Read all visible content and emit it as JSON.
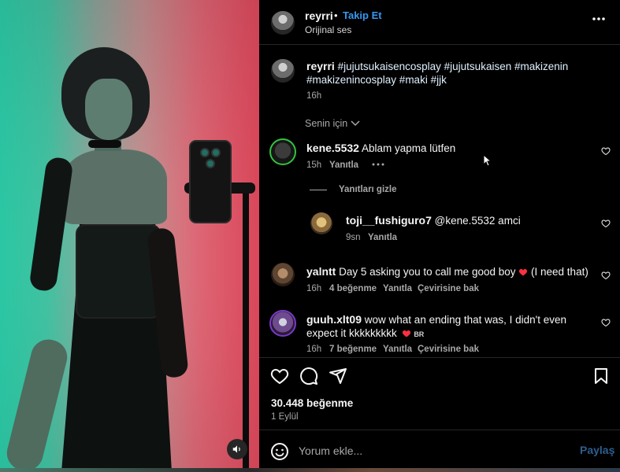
{
  "header": {
    "username": "reyrri",
    "separator": "•",
    "follow_label": "Takip Et",
    "audio_label": "Orijinal ses",
    "more_icon": "more-horizontal-icon"
  },
  "caption": {
    "username": "reyrri",
    "text": "#jujutsukaisencosplay #jujutsukaisen #makizenin #makizenincosplay #maki #jjk",
    "time": "16h"
  },
  "sort": {
    "label": "Senin için"
  },
  "comments": [
    {
      "username": "kene.5532",
      "text": "Ablam yapma lütfen",
      "time": "15h",
      "reply_label": "Yanıtla"
    },
    {
      "username": "toji__fushiguro7",
      "text": "@kene.5532 amci",
      "time": "9sn",
      "reply_label": "Yanıtla"
    },
    {
      "username": "yalntt",
      "text": "Day 5 asking you to call me good boy",
      "suffix": "(I need that)",
      "time": "16h",
      "likes": "4 beğenme",
      "reply_label": "Yanıtla",
      "translate_label": "Çevirisine bak"
    },
    {
      "username": "guuh.xlt09",
      "text": "wow what an ending that was, I didn't even expect it kkkkkkkkk",
      "flag": "BR",
      "time": "16h",
      "likes": "7 beğenme",
      "reply_label": "Yanıtla",
      "translate_label": "Çevirisine bak"
    }
  ],
  "hide_replies_label": "Yanıtları gizle",
  "actions": {
    "likes": "30.448 beğenme",
    "date": "1 Eylül"
  },
  "composer": {
    "placeholder": "Yorum ekle...",
    "post_label": "Paylaş"
  },
  "colors": {
    "follow": "#3797f0",
    "background": "#000000",
    "muted": "#a8a8a8",
    "heart_red": "#ff3040"
  }
}
